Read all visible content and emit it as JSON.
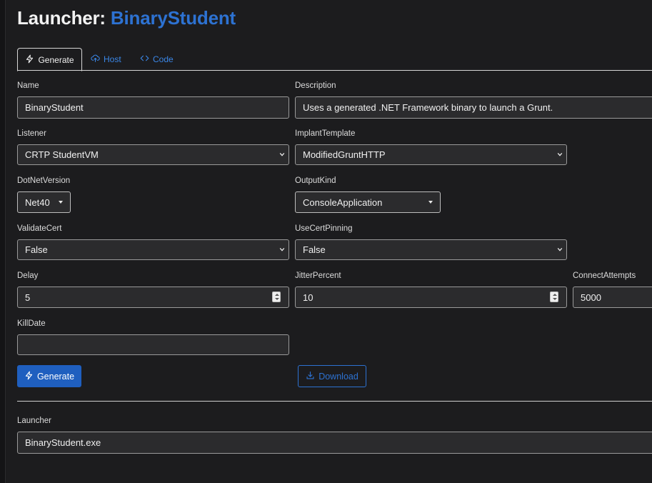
{
  "page": {
    "title_prefix": "Launcher: ",
    "title_name": "BinaryStudent"
  },
  "tabs": [
    {
      "label": "Generate",
      "icon": "bolt-icon",
      "active": true
    },
    {
      "label": "Host",
      "icon": "cloud-upload-icon",
      "active": false
    },
    {
      "label": "Code",
      "icon": "code-icon",
      "active": false
    }
  ],
  "form": {
    "name": {
      "label": "Name",
      "value": "BinaryStudent"
    },
    "description": {
      "label": "Description",
      "value": "Uses a generated .NET Framework binary to launch a Grunt."
    },
    "listener": {
      "label": "Listener",
      "value": "CRTP StudentVM"
    },
    "implant_template": {
      "label": "ImplantTemplate",
      "value": "ModifiedGruntHTTP"
    },
    "dotnet_version": {
      "label": "DotNetVersion",
      "value": "Net40"
    },
    "output_kind": {
      "label": "OutputKind",
      "value": "ConsoleApplication"
    },
    "validate_cert": {
      "label": "ValidateCert",
      "value": "False"
    },
    "use_cert_pinning": {
      "label": "UseCertPinning",
      "value": "False"
    },
    "delay": {
      "label": "Delay",
      "value": "5"
    },
    "jitter_percent": {
      "label": "JitterPercent",
      "value": "10"
    },
    "connect_attempts": {
      "label": "ConnectAttempts",
      "value": "5000"
    },
    "kill_date": {
      "label": "KillDate",
      "value": ""
    }
  },
  "actions": {
    "generate_label": "Generate",
    "download_label": "Download"
  },
  "launcher": {
    "label": "Launcher",
    "value": "BinaryStudent.exe"
  },
  "colors": {
    "accent": "#2d72d2",
    "primary_button": "#1f5fbf",
    "background": "#1c1c1e",
    "input_background": "#2b2b2d"
  }
}
